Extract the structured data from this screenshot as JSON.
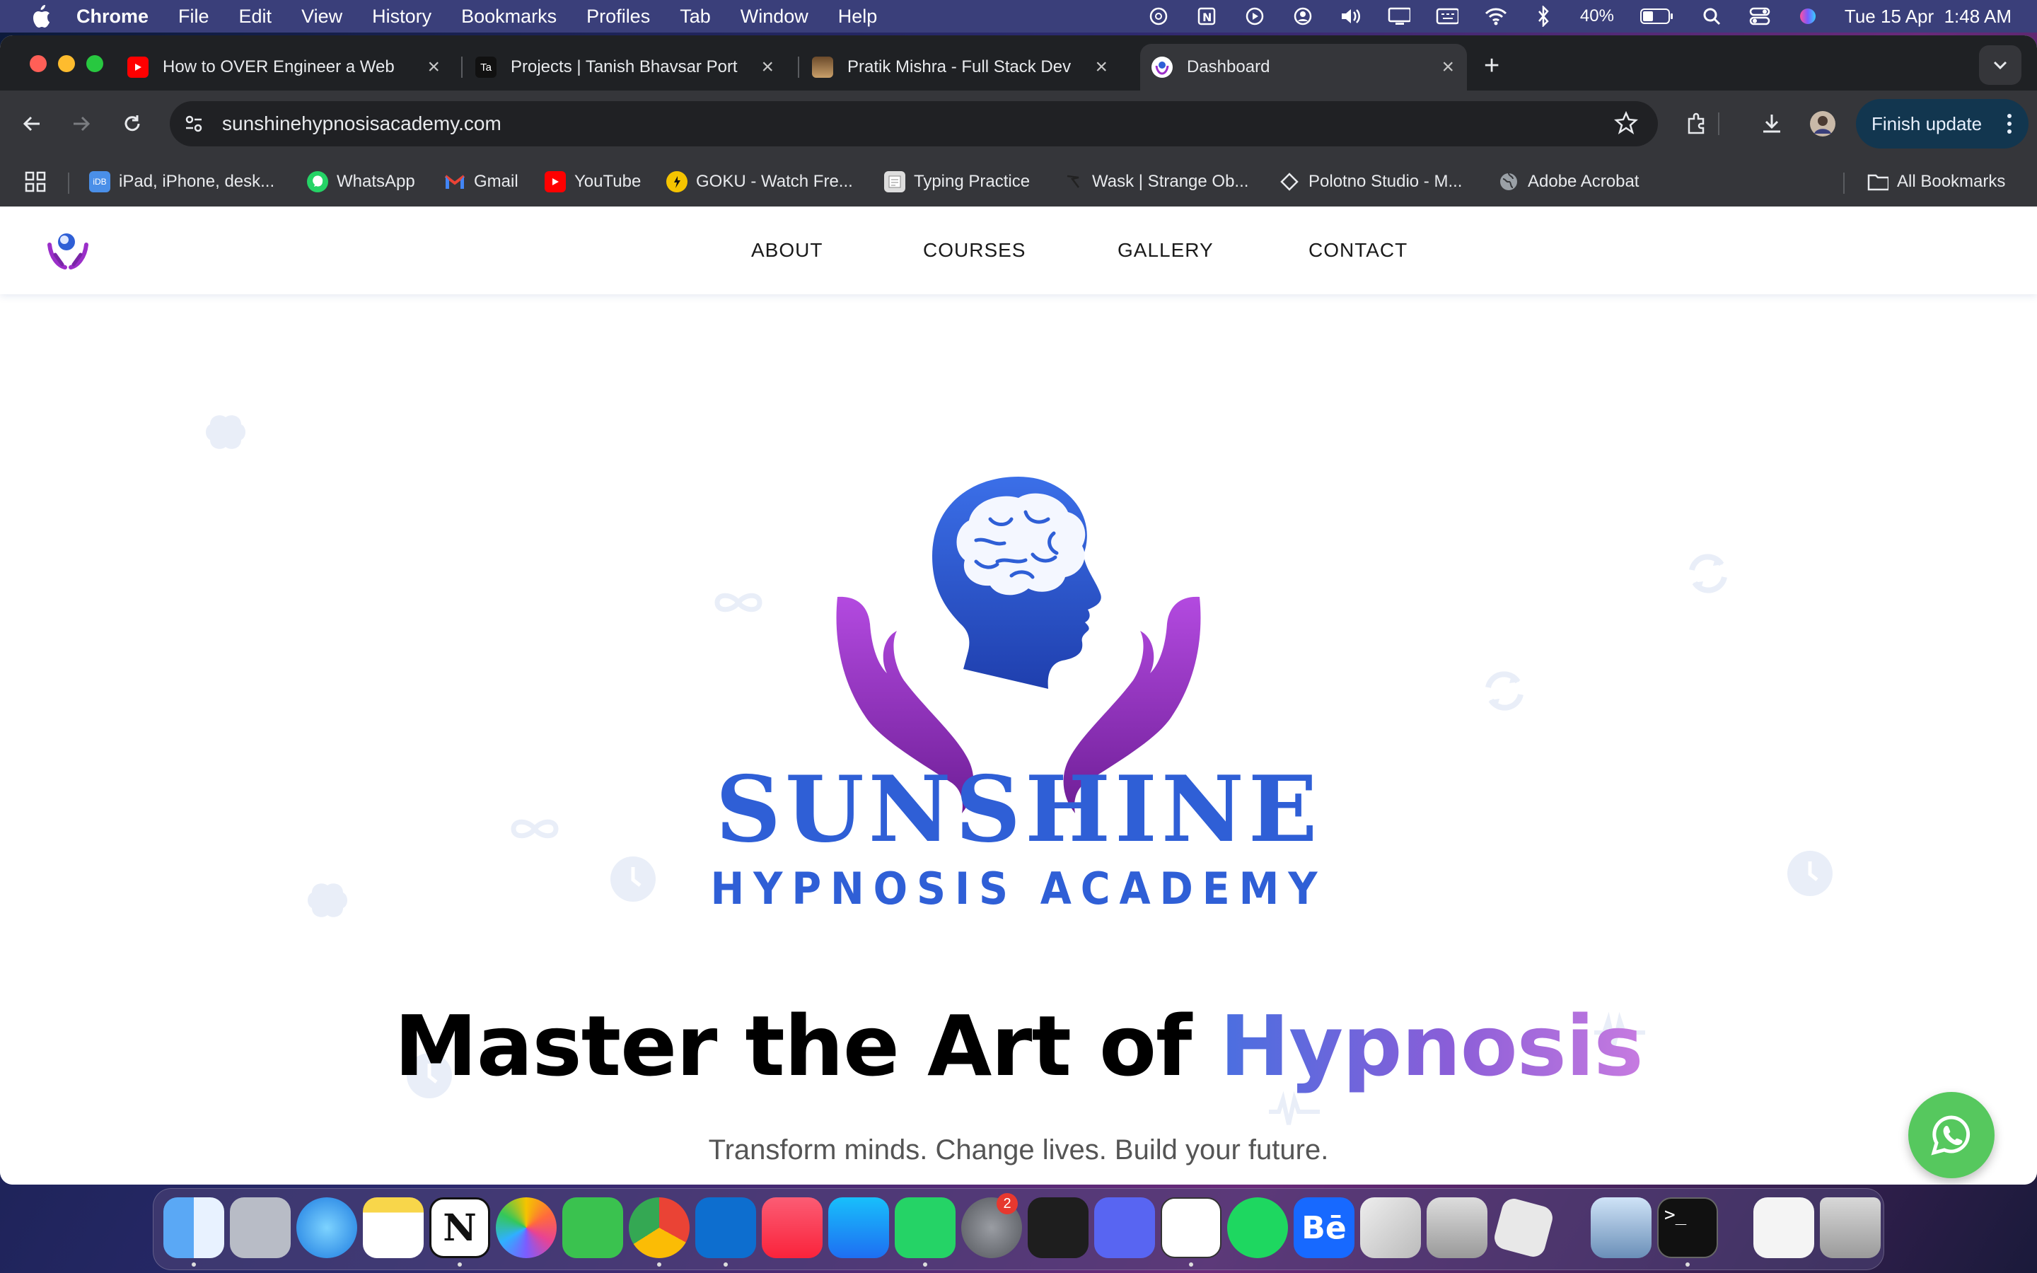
{
  "menubar": {
    "app_name": "Chrome",
    "items": [
      "File",
      "Edit",
      "View",
      "History",
      "Bookmarks",
      "Profiles",
      "Tab",
      "Window",
      "Help"
    ],
    "battery": "40%",
    "datetime": "Tue 15 Apr  1:48 AM"
  },
  "tabs": [
    {
      "title": "How to OVER Engineer a Web",
      "favicon": "youtube-icon",
      "active": false
    },
    {
      "title": "Projects | Tanish Bhavsar Port",
      "favicon": "ta-icon",
      "active": false
    },
    {
      "title": "Pratik Mishra - Full Stack Dev",
      "favicon": "avatar-icon",
      "active": false
    },
    {
      "title": "Dashboard",
      "favicon": "site-logo-icon",
      "active": true
    }
  ],
  "toolbar": {
    "url": "sunshinehypnosisacademy.com",
    "finish_update_label": "Finish update"
  },
  "bookmarks": [
    {
      "label": "iPad, iPhone, desk...",
      "icon": "idb-icon"
    },
    {
      "label": "WhatsApp",
      "icon": "whatsapp-icon"
    },
    {
      "label": "Gmail",
      "icon": "gmail-icon"
    },
    {
      "label": "YouTube",
      "icon": "youtube-icon"
    },
    {
      "label": "GOKU - Watch Fre...",
      "icon": "goku-icon"
    },
    {
      "label": "Typing Practice",
      "icon": "typing-icon"
    },
    {
      "label": "Wask | Strange Ob...",
      "icon": "wask-icon"
    },
    {
      "label": "Polotno Studio - M...",
      "icon": "polotno-icon"
    },
    {
      "label": "Adobe Acrobat",
      "icon": "globe-icon"
    }
  ],
  "all_bookmarks_label": "All Bookmarks",
  "site": {
    "nav": [
      "ABOUT",
      "COURSES",
      "GALLERY",
      "CONTACT"
    ],
    "brand_primary": "SUNSHINE",
    "brand_secondary": "HYPNOSIS ACADEMY",
    "headline_plain": "Master the Art of ",
    "headline_accent": "Hypnosis",
    "tagline": "Transform minds. Change lives. Build your future.",
    "colors": {
      "brand_blue": "#2f5fd6",
      "brand_purple": "#9b2fc9",
      "whatsapp_green": "#56c85e"
    }
  },
  "dock": {
    "apps": [
      "Finder",
      "Launchpad",
      "Safari",
      "Notes",
      "Notion",
      "Photos",
      "FaceTime",
      "Chrome",
      "VS Code",
      "Music",
      "App Store",
      "WhatsApp",
      "System Settings",
      "Figma",
      "Discord",
      "ChatGPT",
      "Spotify",
      "Behance",
      "Affinity",
      "Simulator",
      "Roblox",
      "Preview",
      "Terminal",
      "Documents",
      "Trash"
    ],
    "settings_badge": "2"
  }
}
